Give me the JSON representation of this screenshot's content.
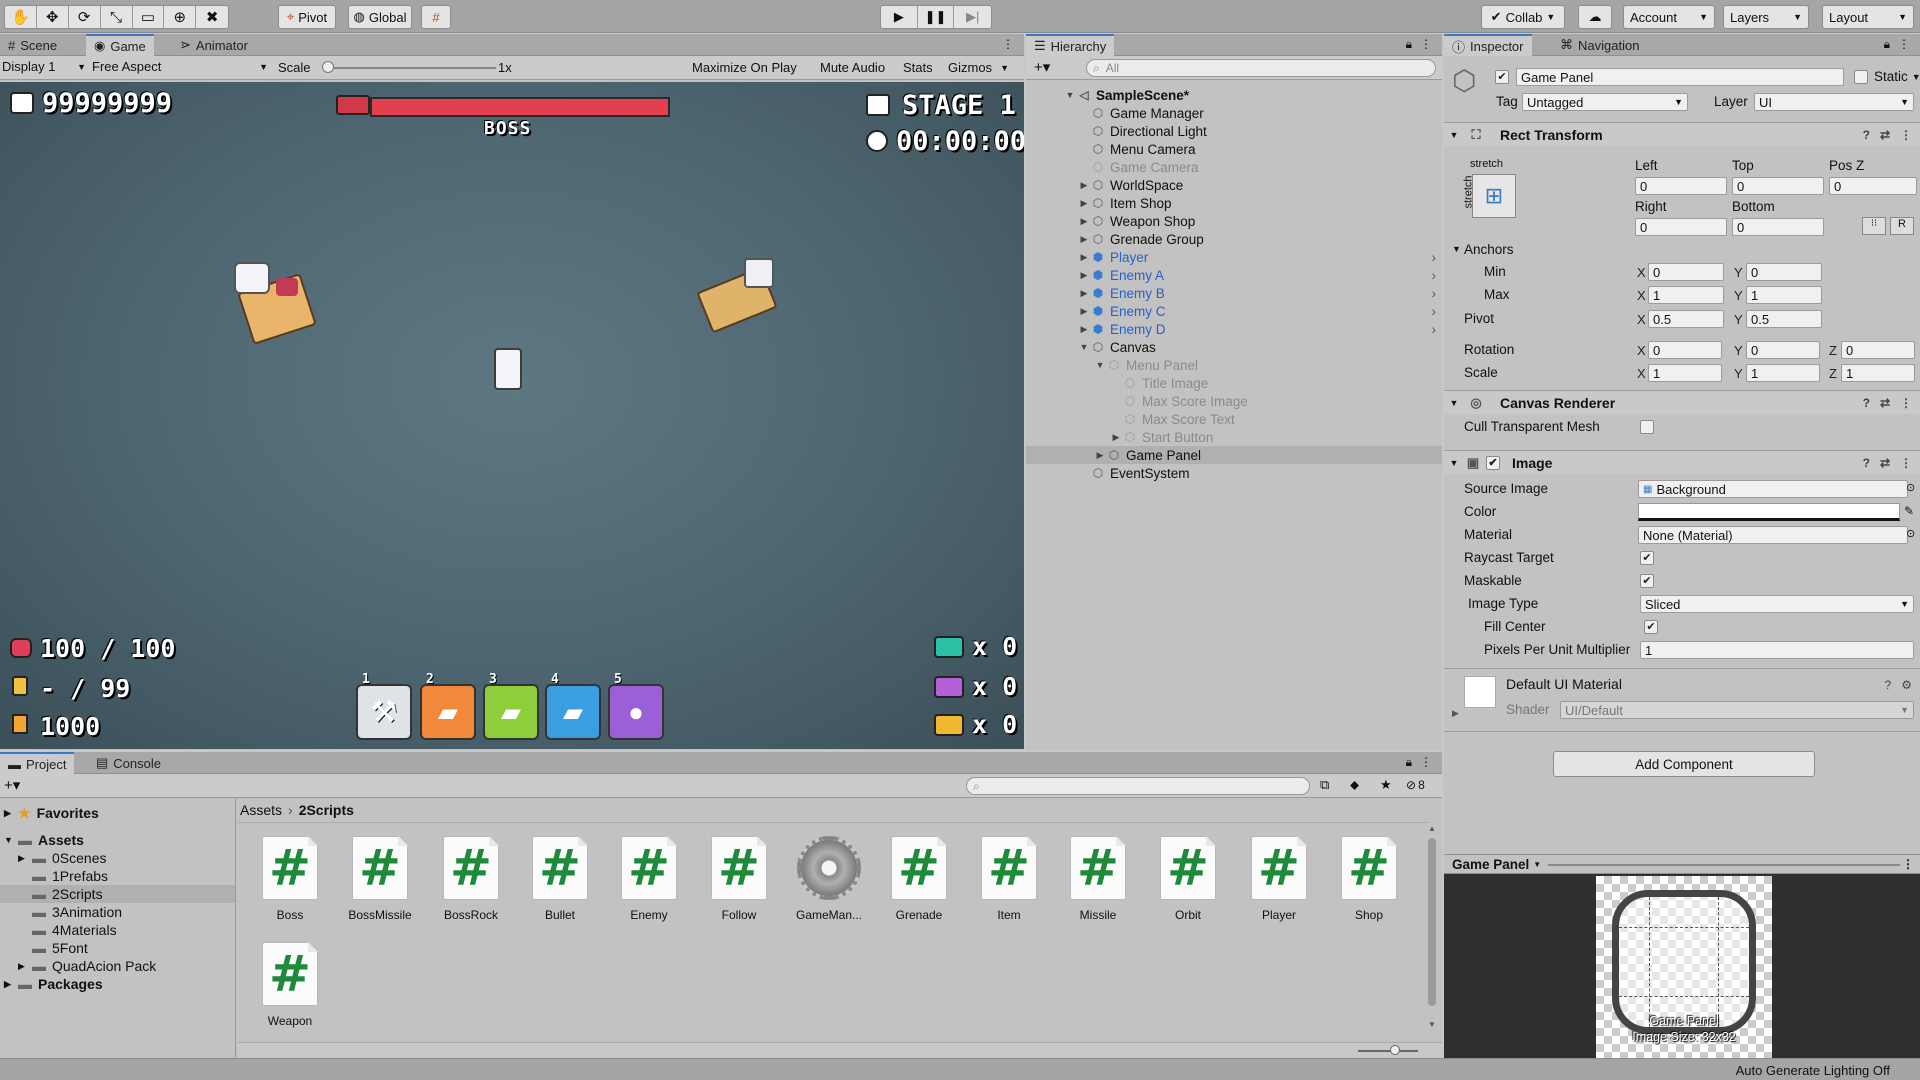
{
  "toolbar": {
    "pivot_label": "Pivot",
    "global_label": "Global",
    "collab_label": "Collab",
    "account_label": "Account",
    "layers_label": "Layers",
    "layout_label": "Layout"
  },
  "scene_tabs": [
    "Scene",
    "Game",
    "Animator"
  ],
  "game_bar": {
    "display": "Display 1",
    "aspect": "Free Aspect",
    "scale_label": "Scale",
    "scale_value": "1x",
    "maximize": "Maximize On Play",
    "mute": "Mute Audio",
    "stats": "Stats",
    "gizmos": "Gizmos"
  },
  "game_ui": {
    "score": "99999999",
    "boss_label": "BOSS",
    "stage": "STAGE 1",
    "timer": "00:00:00",
    "health": "100 / 100",
    "ammo": "- / 99",
    "coins": "1000",
    "enemy_counts": [
      "x 0",
      "x 0",
      "x 0"
    ],
    "weapon_slots": [
      "1",
      "2",
      "3",
      "4",
      "5"
    ]
  },
  "hierarchy": {
    "title": "Hierarchy",
    "search_placeholder": "All",
    "scene": "SampleScene*",
    "items": [
      {
        "label": "Game Manager"
      },
      {
        "label": "Directional Light"
      },
      {
        "label": "Menu Camera"
      },
      {
        "label": "Game Camera"
      },
      {
        "label": "WorldSpace"
      },
      {
        "label": "Item Shop"
      },
      {
        "label": "Weapon Shop"
      },
      {
        "label": "Grenade Group"
      },
      {
        "label": "Player"
      },
      {
        "label": "Enemy A"
      },
      {
        "label": "Enemy B"
      },
      {
        "label": "Enemy C"
      },
      {
        "label": "Enemy D"
      },
      {
        "label": "Canvas"
      },
      {
        "label": "Menu Panel"
      },
      {
        "label": "Title Image"
      },
      {
        "label": "Max Score Image"
      },
      {
        "label": "Max Score Text"
      },
      {
        "label": "Start Button"
      },
      {
        "label": "Game Panel"
      },
      {
        "label": "EventSystem"
      }
    ]
  },
  "inspector": {
    "tabs": [
      "Inspector",
      "Navigation"
    ],
    "object_name": "Game Panel",
    "static_label": "Static",
    "tag_label": "Tag",
    "tag_value": "Untagged",
    "layer_label": "Layer",
    "layer_value": "UI",
    "rect": {
      "title": "Rect Transform",
      "stretch": "stretch",
      "left_label": "Left",
      "left": "0",
      "top_label": "Top",
      "top": "0",
      "posz_label": "Pos Z",
      "posz": "0",
      "right_label": "Right",
      "right": "0",
      "bottom_label": "Bottom",
      "bottom": "0",
      "anchors": "Anchors",
      "min": "Min",
      "min_x": "0",
      "min_y": "0",
      "max": "Max",
      "max_x": "1",
      "max_y": "1",
      "pivot": "Pivot",
      "pivot_x": "0.5",
      "pivot_y": "0.5",
      "rotation": "Rotation",
      "rot_x": "0",
      "rot_y": "0",
      "rot_z": "0",
      "scale": "Scale",
      "scale_x": "1",
      "scale_y": "1",
      "scale_z": "1"
    },
    "canvas_renderer": {
      "title": "Canvas Renderer",
      "cull": "Cull Transparent Mesh"
    },
    "image": {
      "title": "Image",
      "source_label": "Source Image",
      "source_value": "Background",
      "color_label": "Color",
      "material_label": "Material",
      "material_value": "None (Material)",
      "raycast_label": "Raycast Target",
      "maskable_label": "Maskable",
      "type_label": "Image Type",
      "type_value": "Sliced",
      "fill_label": "Fill Center",
      "ppu_label": "Pixels Per Unit Multiplier",
      "ppu_value": "1"
    },
    "material": {
      "title": "Default UI Material",
      "shader_label": "Shader",
      "shader_value": "UI/Default"
    },
    "add_component": "Add Component",
    "preview": {
      "title": "Game Panel",
      "caption1": "Game Panel",
      "caption2": "Image Size: 32x32"
    }
  },
  "project": {
    "tabs": [
      "Project",
      "Console"
    ],
    "favorites": "Favorites",
    "assets_root": "Assets",
    "folders": [
      "0Scenes",
      "1Prefabs",
      "2Scripts",
      "3Animation",
      "4Materials",
      "5Font",
      "QuadAcion Pack"
    ],
    "packages": "Packages",
    "breadcrumb": [
      "Assets",
      "2Scripts"
    ],
    "hidden_count": "8",
    "assets": [
      "Boss",
      "BossMissile",
      "BossRock",
      "Bullet",
      "Enemy",
      "Follow",
      "GameMan...",
      "Grenade",
      "Item",
      "Missile",
      "Orbit",
      "Player",
      "Shop",
      "Weapon"
    ]
  },
  "status": "Auto Generate Lighting Off",
  "colors": {
    "editor_bg": "#c2c2c2",
    "selection": "#b0b0b0",
    "prefab_blue": "#2a5fc0",
    "script_green": "#1e8a3a",
    "boss_bar": "#e2404f"
  }
}
